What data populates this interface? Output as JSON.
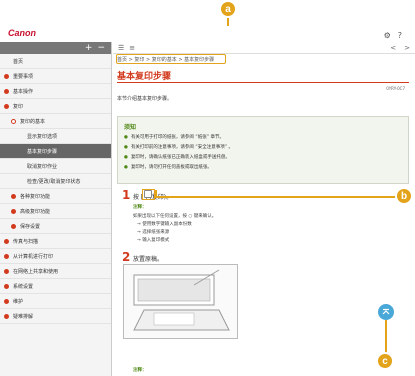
{
  "header": {
    "logo": "Canon",
    "settings_icon": "gear-icon",
    "help_icon": "help-icon"
  },
  "sidebar": {
    "controls": {
      "expand": "+",
      "collapse": "−"
    },
    "items": [
      {
        "label": "首页",
        "bullet": "none",
        "indent": 0
      },
      {
        "label": "重要事项",
        "bullet": "red",
        "indent": 0
      },
      {
        "label": "基本操作",
        "bullet": "red",
        "indent": 0
      },
      {
        "label": "复印",
        "bullet": "red",
        "indent": 0
      },
      {
        "label": "复印的基本",
        "bullet": "hollow",
        "indent": 1
      },
      {
        "label": "显示复印选项",
        "bullet": "none",
        "indent": 2
      },
      {
        "label": "基本复印步骤",
        "bullet": "none",
        "indent": 2,
        "selected": true
      },
      {
        "label": "取消复印作业",
        "bullet": "none",
        "indent": 2
      },
      {
        "label": "检查/更改/取消复印状态",
        "bullet": "none",
        "indent": 2
      },
      {
        "label": "各种复印功能",
        "bullet": "red",
        "indent": 1
      },
      {
        "label": "高级复印功能",
        "bullet": "red",
        "indent": 1
      },
      {
        "label": "保存设置",
        "bullet": "red",
        "indent": 1
      },
      {
        "label": "传真与扫描",
        "bullet": "red",
        "indent": 0
      },
      {
        "label": "从计算机进行打印",
        "bullet": "red",
        "indent": 0
      },
      {
        "label": "在网络上共享和使用",
        "bullet": "red",
        "indent": 0
      },
      {
        "label": "系统设置",
        "bullet": "red",
        "indent": 0
      },
      {
        "label": "维护",
        "bullet": "red",
        "indent": 0
      },
      {
        "label": "疑难排解",
        "bullet": "red",
        "indent": 0
      }
    ]
  },
  "content": {
    "toolbar": {
      "list_icon": "list-icon",
      "title_icon": "≡",
      "prev": "<",
      "next": ">"
    },
    "breadcrumb": "首页 > 复印 > 复印的基本 > 基本复印步骤",
    "title": "基本复印步骤",
    "doc_id": "0YRY-0C7",
    "intro": "本节介绍基本复印步骤。",
    "important": {
      "title": "须知",
      "lines": [
        "有关可用于打印的纸张，请参阅 “纸张” 章节。",
        "有关打印前的注意事项，请参阅 “安全注意事项” 。",
        "复印时，请确认纸张已正确装入纸盒或手送托盘。",
        "复印时，请勿打开任何盖板或取出纸张。"
      ]
    },
    "steps": [
      {
        "num": "1",
        "text": "按 [ ] (复印)。",
        "note": "注释：",
        "sub": [
          "如果出现以下任何设置，按 ○ 键来确认。",
          "→ 使用数字键输入副本份数",
          "→ 选择纸张来源",
          "→ 输入复印模式"
        ]
      },
      {
        "num": "2",
        "text": "放置原稿。",
        "note": "注释：",
        "sub": []
      }
    ]
  },
  "callouts": {
    "a": "a",
    "b": "b",
    "c": "c"
  },
  "back_to_top": "⌃"
}
